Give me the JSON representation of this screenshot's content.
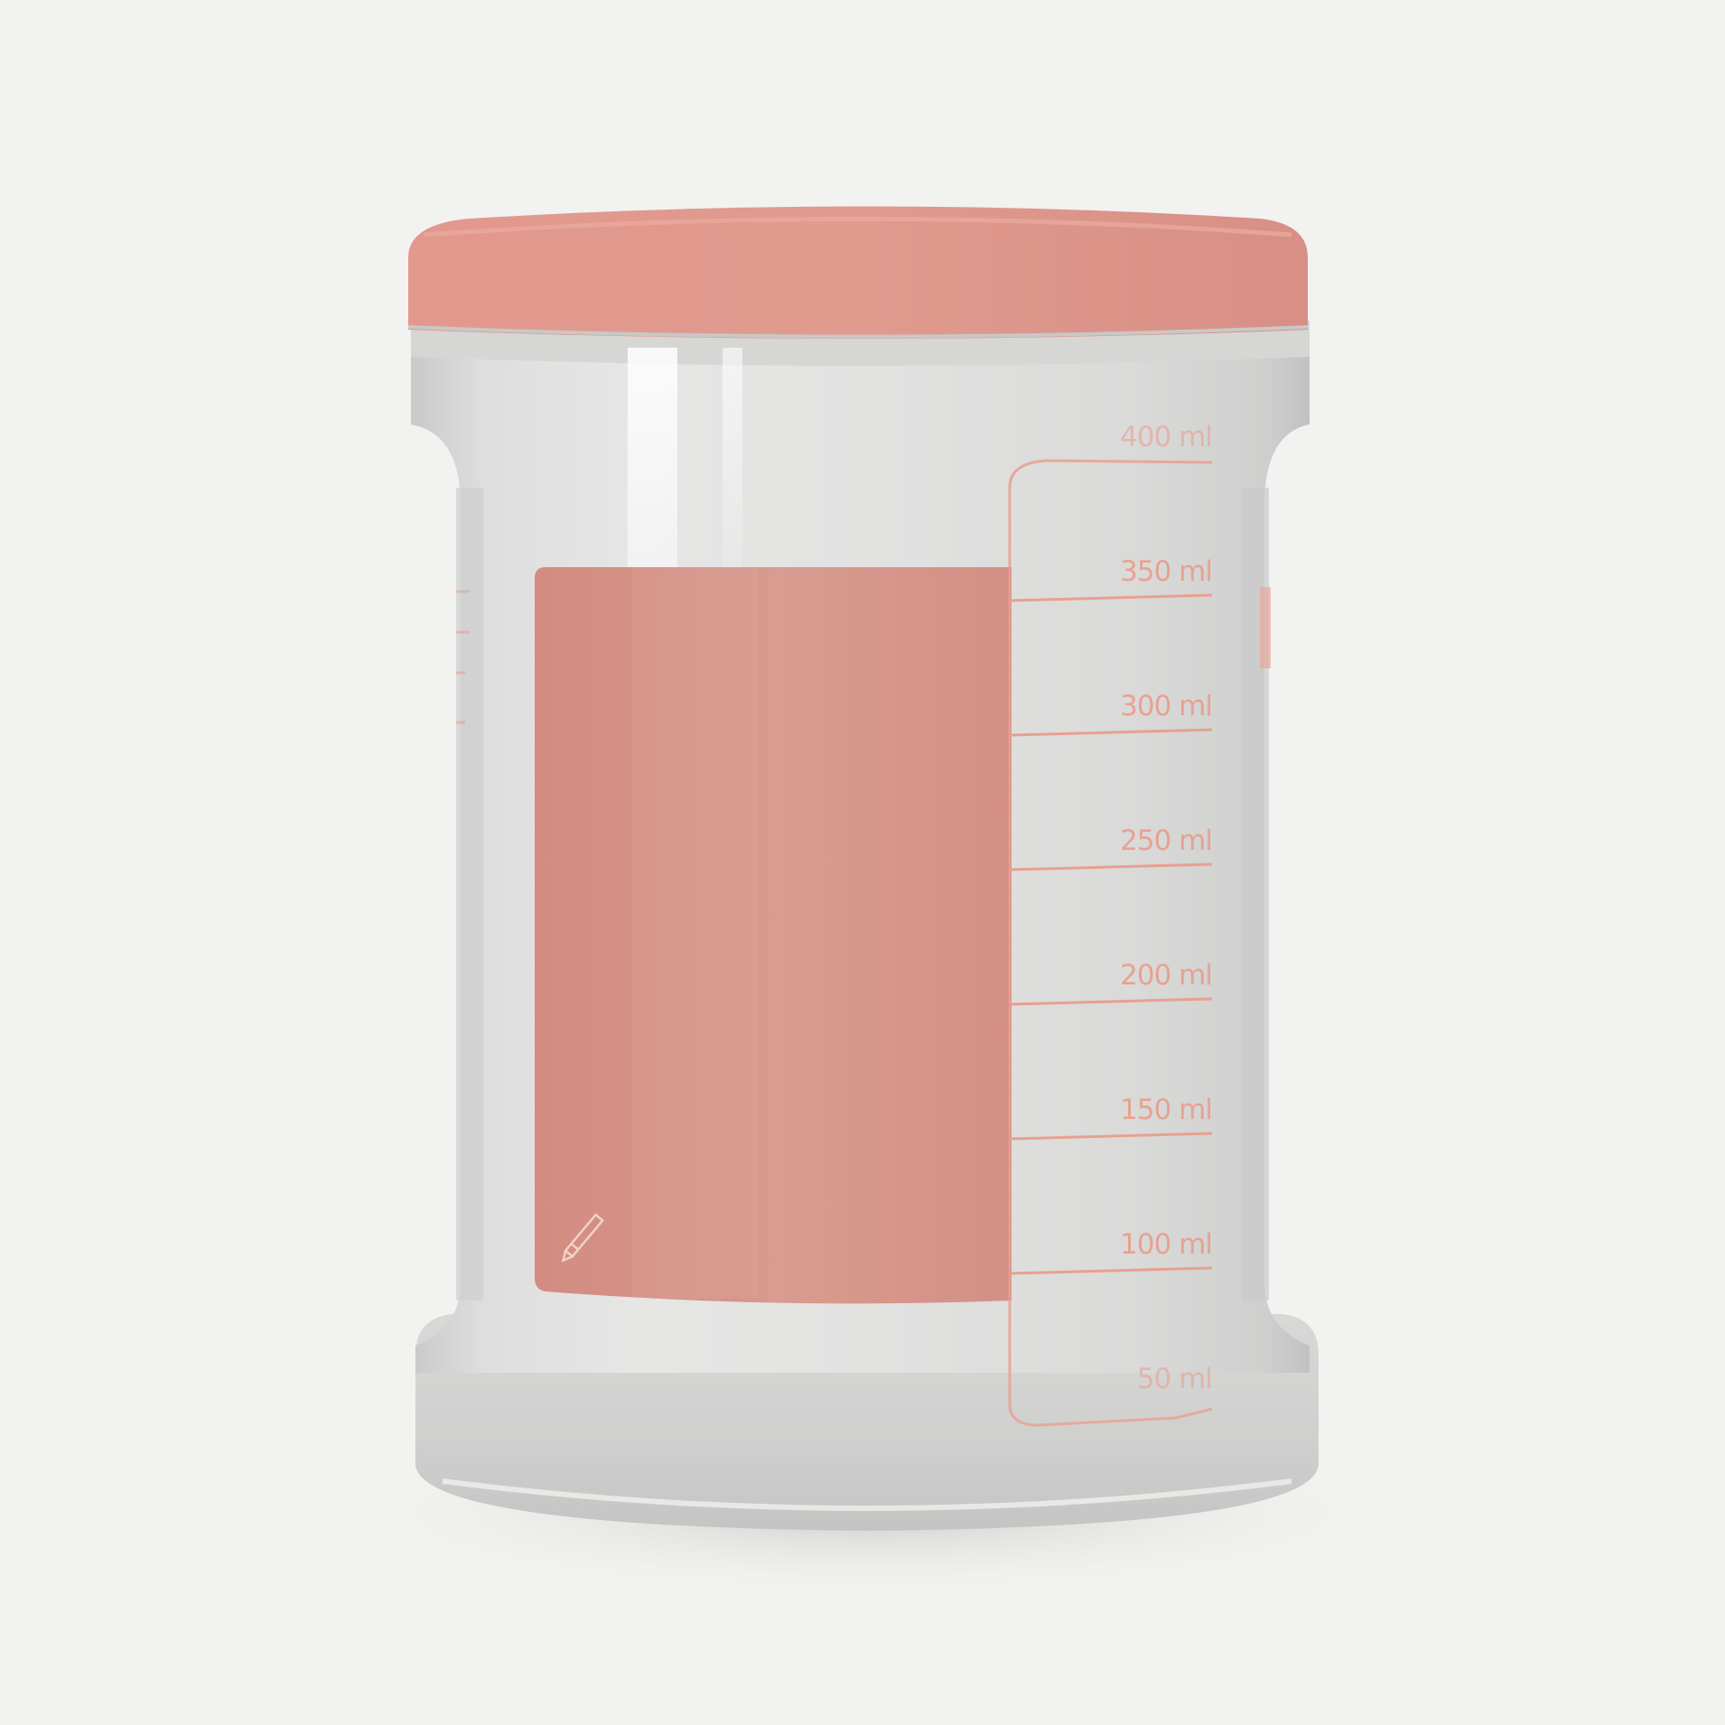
{
  "scene": {
    "subject": "graduated container with lid",
    "background_color": "#f2f2f0",
    "lid_color": "#e0958a",
    "label_color": "#d39086",
    "marking_color": "#e8a08f",
    "glass_color": "#dcdcdb"
  },
  "graduations": [
    {
      "label": "400 ml",
      "volume_ml": 400
    },
    {
      "label": "350 ml",
      "volume_ml": 350
    },
    {
      "label": "300 ml",
      "volume_ml": 300
    },
    {
      "label": "250 ml",
      "volume_ml": 250
    },
    {
      "label": "200 ml",
      "volume_ml": 200
    },
    {
      "label": "150 ml",
      "volume_ml": 150
    },
    {
      "label": "100 ml",
      "volume_ml": 100
    },
    {
      "label": "50 ml",
      "volume_ml": 50
    }
  ],
  "label_area": {
    "icon": "pencil-icon"
  }
}
